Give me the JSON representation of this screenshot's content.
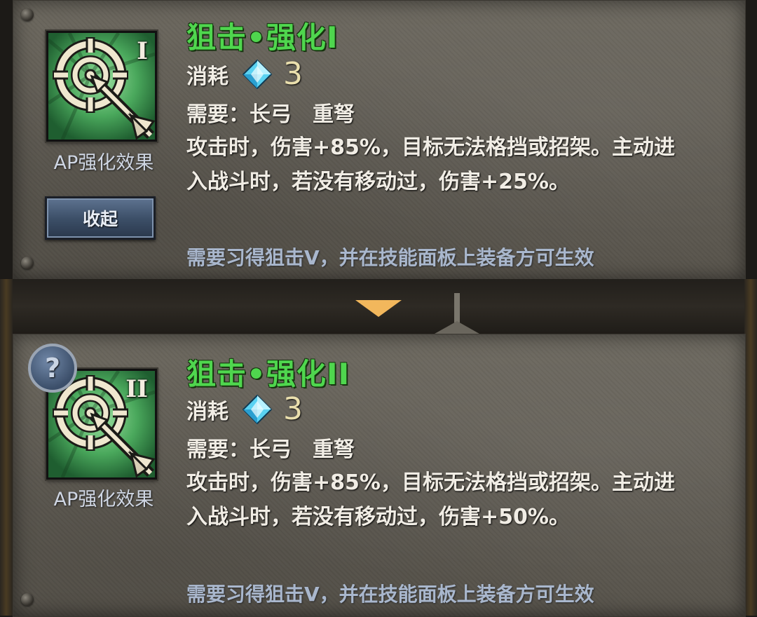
{
  "cards": [
    {
      "tier": "I",
      "title": "狙击•强化I",
      "cost_label": "消耗",
      "cost_value": "3",
      "requirement": "需要：长弓　重弩",
      "description": "攻击时，伤害+85%，目标无法格挡或招架。主动进入战斗时，若没有移动过，伤害+25%。",
      "ap_label": "AP强化效果",
      "button_label": "收起",
      "note": "需要习得狙击V，并在技能面板上装备方可生效"
    },
    {
      "tier": "II",
      "title": "狙击•强化II",
      "cost_label": "消耗",
      "cost_value": "3",
      "requirement": "需要：长弓　重弩",
      "description": "攻击时，伤害+85%，目标无法格挡或招架。主动进入战斗时，若没有移动过，伤害+50%。",
      "ap_label": "AP强化效果",
      "help_label": "?",
      "note": "需要习得狙击V，并在技能面板上装备方可生效"
    }
  ],
  "colors": {
    "title_green": "#4fd64e",
    "cost_gold": "#eadfad",
    "note_blue": "#a9b7cd",
    "icon_green": "#3f9b52",
    "divider_arrow": "#f2b75c"
  },
  "icons": [
    "target-crosshair-arrow-icon",
    "diamond-gem-icon",
    "question-mark-icon"
  ]
}
